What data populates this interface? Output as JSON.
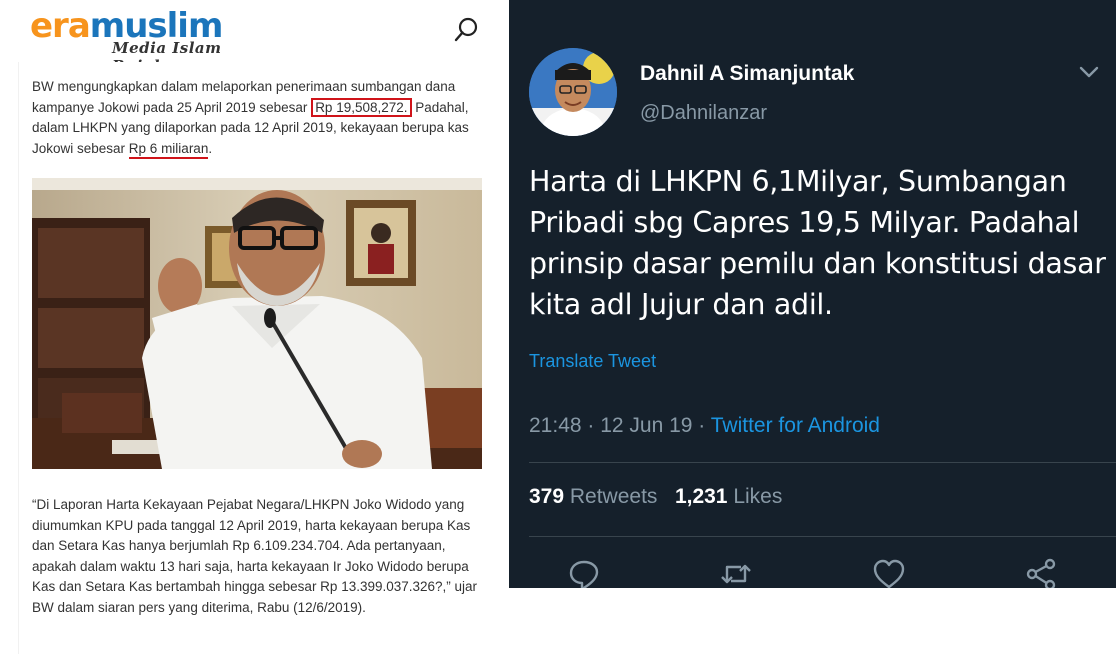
{
  "article": {
    "site": {
      "logo_era": "era",
      "logo_muslim": "muslim",
      "tagline": "Media Islam Rujukan",
      "brand_colors": {
        "era": "#f7941d",
        "muslim": "#1b75bb"
      },
      "search_icon": "search-icon"
    },
    "para1": {
      "text1": "BW mengungkapkan dalam melaporkan penerimaan sumbangan dana kampanye Jokowi pada 25 April 2019 sebesar ",
      "boxed": "Rp 19,508,272.",
      "text2": " Padahal, dalam LHKPN yang dilaporkan pada 12 April 2019, kekayaan berupa kas Jokowi sebesar ",
      "underlined": "Rp 6 miliaran",
      "text3": "."
    },
    "para2": "“Di Laporan Harta Kekayaan Pejabat Negara/LHKPN Joko Widodo yang diumumkan KPU pada tanggal 12 April 2019, harta kekayaan berupa Kas dan Setara Kas hanya berjumlah Rp 6.109.234.704. Ada pertanyaan, apakah dalam waktu 13 hari saja, harta kekayaan Ir Joko Widodo berupa Kas dan Setara Kas bertambah hingga sebesar Rp 13.399.037.326?,” ujar BW dalam siaran pers yang diterima, Rabu (12/6/2019).",
    "highlight_color": "#d0141a"
  },
  "tweet": {
    "display_name": "Dahnil A Simanjuntak",
    "handle": "@Dahnilanzar",
    "text": "Harta di LHKPN 6,1Milyar, Sumbangan Pribadi sbg Capres 19,5 Milyar. Padahal prinsip dasar pemilu dan konstitusi dasar kita adl Jujur dan adil.",
    "translate_label": "Translate Tweet",
    "time": "21:48 · 12 Jun 19 · ",
    "source": "Twitter for Android",
    "retweets_count": "379",
    "retweets_label": " Retweets",
    "likes_count": "1,231",
    "likes_label": " Likes",
    "actions": [
      "reply-icon",
      "retweet-icon",
      "like-icon",
      "share-icon"
    ],
    "colors": {
      "background": "#15202b",
      "link": "#1b95e0",
      "muted": "#8899a6"
    }
  }
}
